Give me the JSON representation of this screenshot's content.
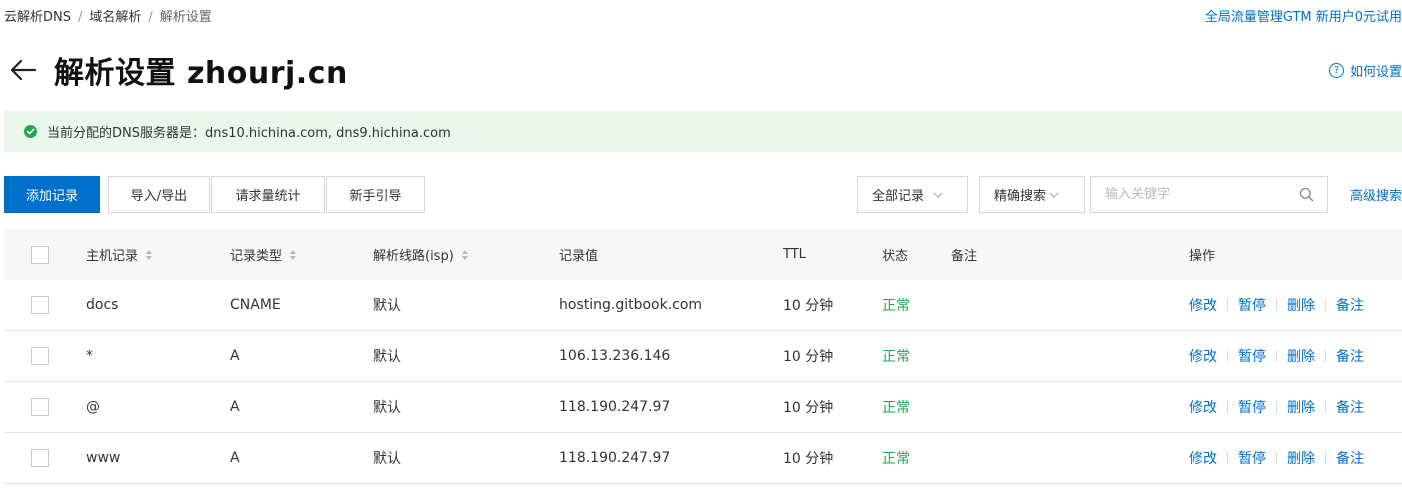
{
  "breadcrumb": {
    "items": [
      "云解析DNS",
      "域名解析",
      "解析设置"
    ],
    "separator": "/"
  },
  "promo": {
    "label": "全局流量管理GTM 新用户0元试用"
  },
  "header": {
    "title": "解析设置 zhourj.cn",
    "help_label": "如何设置",
    "help_icon": "?"
  },
  "notice": {
    "text": "当前分配的DNS服务器是：dns10.hichina.com, dns9.hichina.com"
  },
  "toolbar": {
    "add_label": "添加记录",
    "import_export_label": "导入/导出",
    "stats_label": "请求量统计",
    "guide_label": "新手引导",
    "filter_selected": "全部记录",
    "search_mode_selected": "精确搜索",
    "search_placeholder": "输入关键字",
    "advanced_search_label": "高级搜索"
  },
  "table": {
    "columns": {
      "host": "主机记录",
      "type": "记录类型",
      "line": "解析线路(isp)",
      "value": "记录值",
      "ttl": "TTL",
      "status": "状态",
      "remark": "备注",
      "actions": "操作"
    },
    "action_labels": {
      "edit": "修改",
      "pause": "暂停",
      "delete": "删除",
      "remark": "备注"
    },
    "rows": [
      {
        "host": "docs",
        "type": "CNAME",
        "line": "默认",
        "value": "hosting.gitbook.com",
        "ttl": "10 分钟",
        "status": "正常",
        "remark": ""
      },
      {
        "host": "*",
        "type": "A",
        "line": "默认",
        "value": "106.13.236.146",
        "ttl": "10 分钟",
        "status": "正常",
        "remark": ""
      },
      {
        "host": "@",
        "type": "A",
        "line": "默认",
        "value": "118.190.247.97",
        "ttl": "10 分钟",
        "status": "正常",
        "remark": ""
      },
      {
        "host": "www",
        "type": "A",
        "line": "默认",
        "value": "118.190.247.97",
        "ttl": "10 分钟",
        "status": "正常",
        "remark": ""
      }
    ]
  },
  "colors": {
    "link": "#0070cc",
    "primary": "#0070cc",
    "success": "#1fa94c",
    "notice_bg": "#e9f7ec"
  }
}
